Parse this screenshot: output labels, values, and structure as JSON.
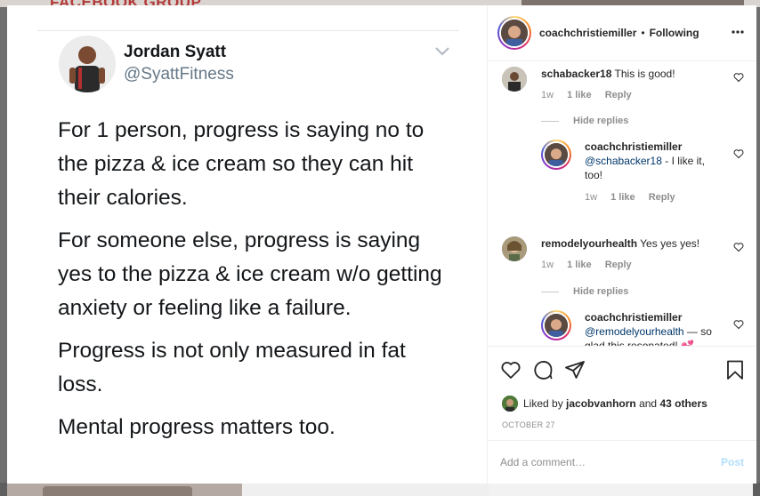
{
  "background": {
    "top_title": "FACEBOOK GROUP"
  },
  "post": {
    "tweet": {
      "name": "Jordan Syatt",
      "handle": "@SyattFitness",
      "paragraphs": [
        "For 1 person, progress is saying no to the pizza & ice cream so they can hit their calories.",
        "For someone else, progress is saying yes to the pizza & ice cream w/o getting anxiety or feeling like a failure.",
        "Progress is not only measured in fat loss.",
        "Mental progress matters too."
      ]
    }
  },
  "header": {
    "username": "coachchristiemiller",
    "separator": "•",
    "follow_status": "Following",
    "more_icon": "more-horizontal-icon"
  },
  "comments": [
    {
      "user": "schabacker18",
      "text": "This is good!",
      "time": "1w",
      "likes": "1 like",
      "reply_label": "Reply",
      "hide_replies": "Hide replies",
      "replies": [
        {
          "user": "coachchristiemiller",
          "mention": "@schabacker18",
          "text": " - I like it, too!",
          "time": "1w",
          "likes": "1 like",
          "reply_label": "Reply"
        }
      ]
    },
    {
      "user": "remodelyourhealth",
      "text": "Yes yes yes!",
      "time": "1w",
      "likes": "1 like",
      "reply_label": "Reply",
      "hide_replies": "Hide replies",
      "replies": [
        {
          "user": "coachchristiemiller",
          "mention": "@remodelyourhealth",
          "text": " — so glad this resonated! 💕"
        }
      ]
    }
  ],
  "actions": {
    "icons": [
      "heart-icon",
      "comment-icon",
      "share-icon",
      "bookmark-icon"
    ]
  },
  "likes": {
    "prefix": "Liked by",
    "user": "jacobvanhorn",
    "and": "and",
    "others": "43 others"
  },
  "date": "OCTOBER 27",
  "add_comment": {
    "placeholder": "Add a comment…",
    "post_label": "Post"
  },
  "colors": {
    "link": "#00376b",
    "muted": "#8e8e8e",
    "post_disabled": "#b2dffc",
    "text": "#262626"
  }
}
